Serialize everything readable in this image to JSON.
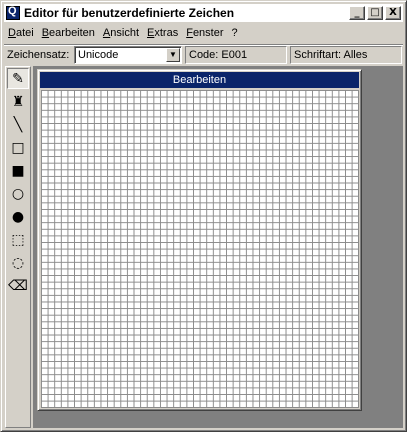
{
  "window": {
    "title": "Editor für benutzerdefinierte Zeichen"
  },
  "title_buttons": {
    "minimize": "_",
    "maximize": "□",
    "close": "X"
  },
  "menu": [
    "Datei",
    "Bearbeiten",
    "Ansicht",
    "Extras",
    "Fenster",
    "?"
  ],
  "toolbar": {
    "charset_label": "Zeichensatz:",
    "charset_value": "Unicode",
    "code": "Code: E001",
    "font": "Schriftart: Alles"
  },
  "tools": [
    {
      "name": "pencil",
      "glyph": "✎"
    },
    {
      "name": "brush",
      "glyph": "♜"
    },
    {
      "name": "line",
      "glyph": "╲"
    },
    {
      "name": "rectangle-outline",
      "glyph": "□"
    },
    {
      "name": "rectangle-filled",
      "glyph": "■"
    },
    {
      "name": "ellipse-outline",
      "glyph": "○"
    },
    {
      "name": "ellipse-filled",
      "glyph": "●"
    },
    {
      "name": "rect-select",
      "glyph": "⬚"
    },
    {
      "name": "freeform-select",
      "glyph": "◌"
    },
    {
      "name": "eraser",
      "glyph": "⌫"
    }
  ],
  "child_window": {
    "title": "Bearbeiten"
  }
}
